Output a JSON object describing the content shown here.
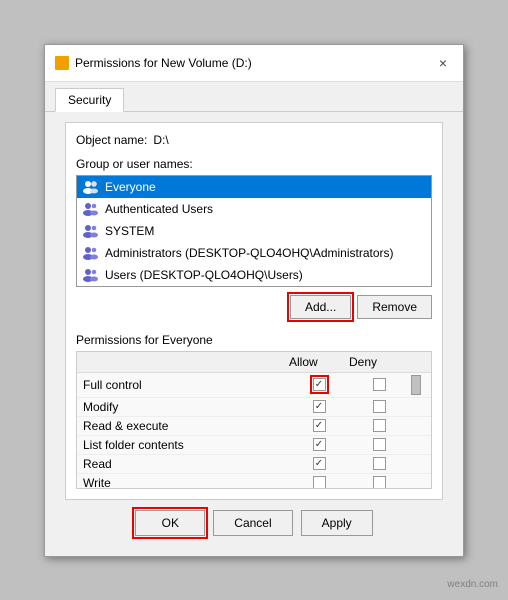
{
  "dialog": {
    "title": "Permissions for New Volume (D:)",
    "close_label": "×"
  },
  "tabs": [
    {
      "label": "Security",
      "active": true
    }
  ],
  "object_name_label": "Object name:",
  "object_name_value": "D:\\",
  "group_label": "Group or user names:",
  "users": [
    {
      "name": "Everyone",
      "selected": true
    },
    {
      "name": "Authenticated Users",
      "selected": false
    },
    {
      "name": "SYSTEM",
      "selected": false
    },
    {
      "name": "Administrators (DESKTOP-QLO4OHQ\\Administrators)",
      "selected": false
    },
    {
      "name": "Users (DESKTOP-QLO4OHQ\\Users)",
      "selected": false
    }
  ],
  "buttons": {
    "add": "Add...",
    "remove": "Remove"
  },
  "permissions_label": "Permissions for Everyone",
  "permissions_columns": {
    "allow": "Allow",
    "deny": "Deny"
  },
  "permissions": [
    {
      "name": "Full control",
      "allow": true,
      "deny": false,
      "allow_highlighted": true
    },
    {
      "name": "Modify",
      "allow": true,
      "deny": false,
      "allow_highlighted": false
    },
    {
      "name": "Read & execute",
      "allow": true,
      "deny": false,
      "allow_highlighted": false
    },
    {
      "name": "List folder contents",
      "allow": true,
      "deny": false,
      "allow_highlighted": false
    },
    {
      "name": "Read",
      "allow": true,
      "deny": false,
      "allow_highlighted": false
    },
    {
      "name": "Write",
      "allow": false,
      "deny": false,
      "allow_highlighted": false
    }
  ],
  "footer": {
    "ok": "OK",
    "cancel": "Cancel",
    "apply": "Apply"
  },
  "watermark": "wexdn.com"
}
